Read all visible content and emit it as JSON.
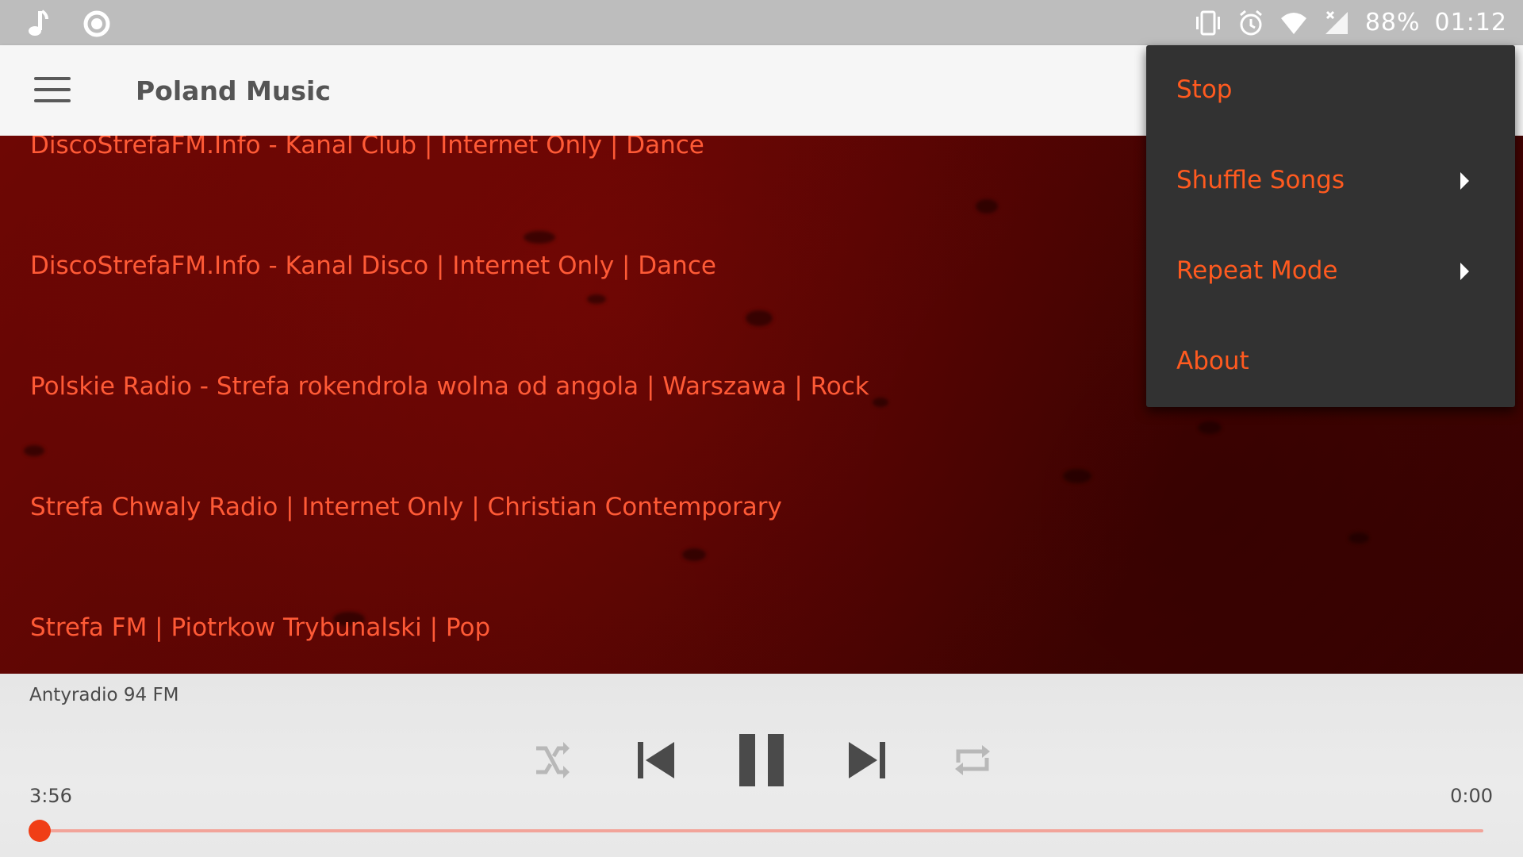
{
  "status_bar": {
    "battery": "88%",
    "time": "01:12",
    "left_icons": [
      "music-note-icon",
      "circle-icon"
    ],
    "right_icons": [
      "vibrate-icon",
      "alarm-icon",
      "wifi-icon",
      "signal-icon"
    ]
  },
  "app_bar": {
    "title": "Poland Music"
  },
  "stations": [
    "DiscoStrefaFM.Info - Kanal Club | Internet Only | Dance",
    "DiscoStrefaFM.Info - Kanal Disco | Internet Only | Dance",
    "Polskie Radio - Strefa rokendrola wolna od angola | Warszawa | Rock",
    "Strefa Chwaly Radio | Internet Only | Christian Contemporary",
    "Strefa FM | Piotrkow Trybunalski | Pop"
  ],
  "menu": {
    "items": [
      {
        "label": "Stop",
        "has_submenu": false
      },
      {
        "label": "Shuffle Songs",
        "has_submenu": true
      },
      {
        "label": "Repeat Mode",
        "has_submenu": true
      },
      {
        "label": "About",
        "has_submenu": false
      }
    ]
  },
  "player": {
    "now_playing": "Antyradio 94 FM",
    "elapsed": "3:56",
    "duration": "0:00",
    "progress": 0.0,
    "state": "playing",
    "controls": [
      "shuffle-icon",
      "previous-icon",
      "pause-icon",
      "next-icon",
      "repeat-icon"
    ]
  },
  "colors": {
    "accent": "#ff5a1f",
    "station_text": "#ff5a36",
    "menu_bg": "#323232",
    "seek_thumb": "#f03e16"
  }
}
